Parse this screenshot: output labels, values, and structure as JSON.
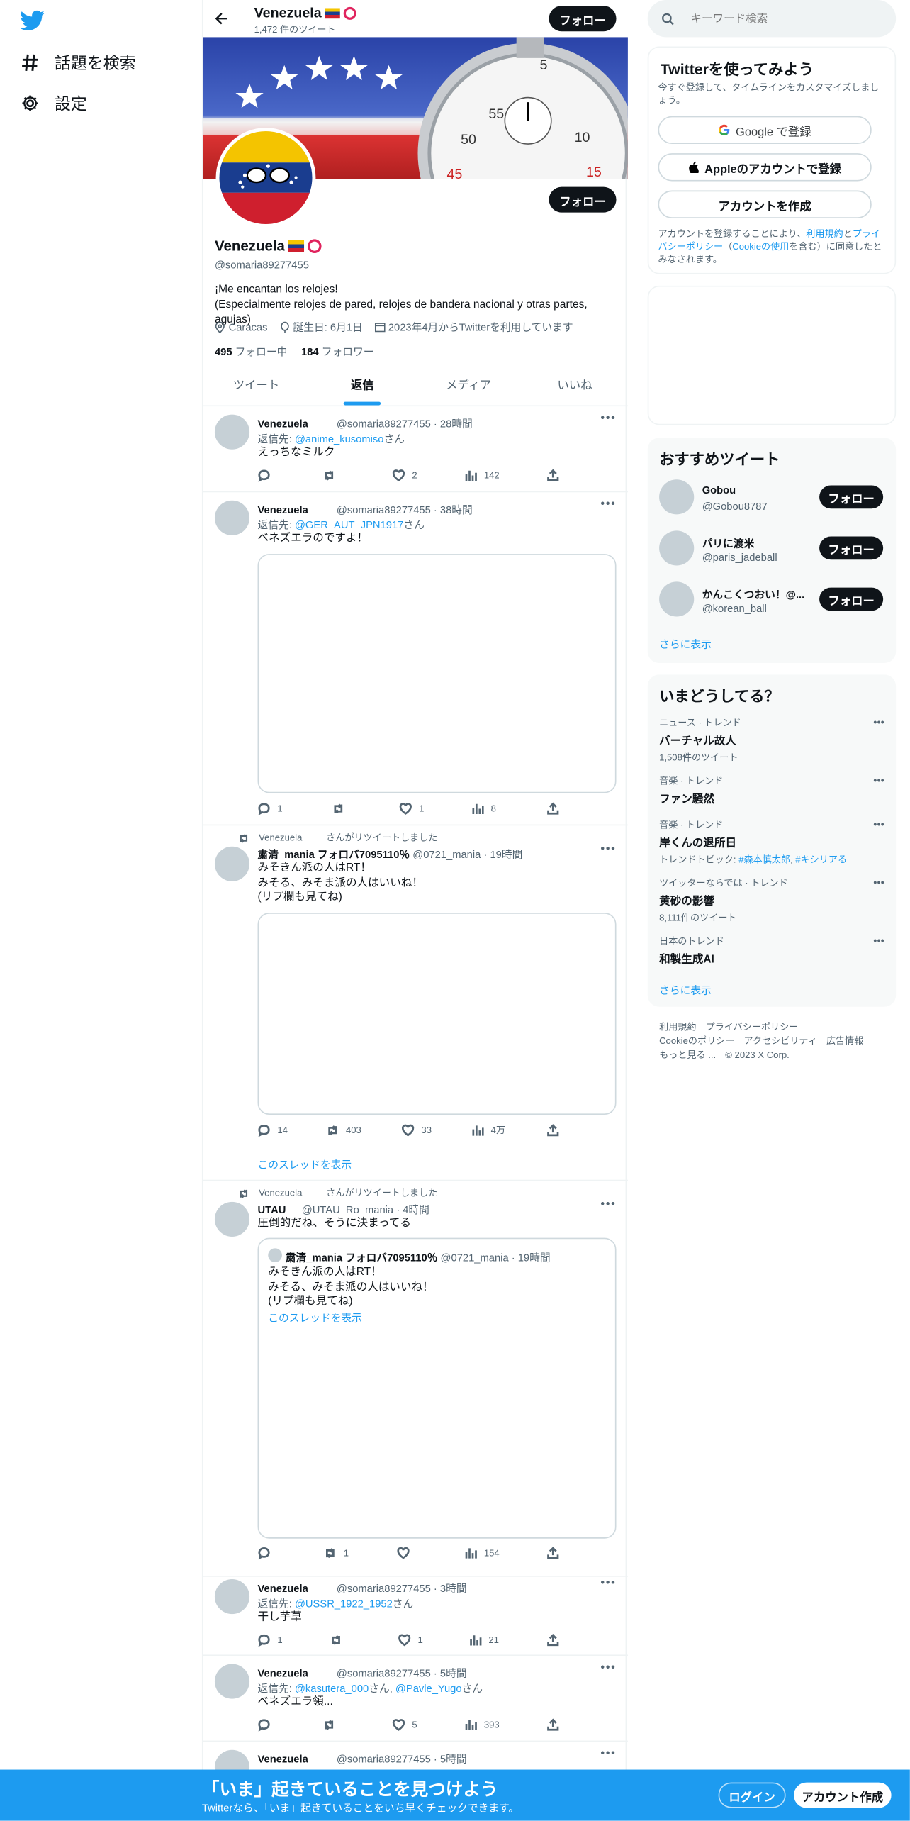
{
  "nav": {
    "explore": "話題を検索",
    "settings": "設定"
  },
  "header": {
    "name": "Venezuela",
    "tweets": "1,472 件のツイート",
    "follow": "フォロー"
  },
  "profile": {
    "name": "Venezuela",
    "handle": "@somaria89277455",
    "bio": "¡Me encantan los relojes!\n(Especialmente relojes de pared, relojes de bandera nacional y otras partes, agujas)",
    "location": "Caracas",
    "birthday": "誕生日: 6月1日",
    "joined": "2023年4月からTwitterを利用しています",
    "following_count": "495",
    "following_label": "フォロー中",
    "followers_count": "184",
    "followers_label": "フォロワー",
    "follow": "フォロー"
  },
  "tabs": [
    "ツイート",
    "返信",
    "メディア",
    "いいね"
  ],
  "tweets": [
    {
      "name": "Venezuela",
      "handle": "@somaria89277455 · 28時間",
      "reply_prefix": "返信先: ",
      "reply_to": "@anime_kusomiso",
      "reply_suffix": "さん",
      "text": "えっちなミルク",
      "reply": "",
      "retweet": "",
      "like": "2",
      "views": "142"
    },
    {
      "name": "Venezuela",
      "handle": "@somaria89277455 · 38時間",
      "reply_prefix": "返信先: ",
      "reply_to": "@GER_AUT_JPN1917",
      "reply_suffix": "さん",
      "text": "ベネズエラのですよ！",
      "reply": "1",
      "retweet": "",
      "like": "1",
      "views": "8"
    },
    {
      "rt_by": "Venezuela",
      "rt_label": "さんがリツイートしました",
      "name": "粛清_mania フォロバ7095110％",
      "handle": "@0721_mania · 19時間",
      "text": "みそきん派の人はRT！\nみそる、みそま派の人はいいね！\n(リプ欄も見てね)",
      "reply": "14",
      "retweet": "403",
      "like": "33",
      "views": "4万",
      "thread": "このスレッドを表示"
    },
    {
      "rt_by": "Venezuela",
      "rt_label": "さんがリツイートしました",
      "name": "UTAU",
      "handle": "@UTAU_Ro_mania · 4時間",
      "text": "圧倒的だね、そうに決まってる",
      "quote": {
        "name": "粛清_mania フォロバ7095110％",
        "handle": "@0721_mania · 19時間",
        "text": "みそきん派の人はRT！\nみそる、みそま派の人はいいね！\n(リプ欄も見てね)",
        "thread": "このスレッドを表示"
      },
      "reply": "",
      "retweet": "1",
      "like": "",
      "views": "154"
    },
    {
      "name": "Venezuela",
      "handle": "@somaria89277455 · 3時間",
      "reply_prefix": "返信先: ",
      "reply_to": "@USSR_1922_1952",
      "reply_suffix": "さん",
      "text": "干し芋草",
      "reply": "1",
      "retweet": "",
      "like": "1",
      "views": "21"
    },
    {
      "name": "Venezuela",
      "handle": "@somaria89277455 · 5時間",
      "reply_prefix": "返信先: ",
      "reply_to": "@kasutera_000",
      "reply_mid": "さん, ",
      "reply_to2": "@Pavle_Yugo",
      "reply_suffix": "さん",
      "text": "ベネズエラ領...",
      "reply": "",
      "retweet": "",
      "like": "5",
      "views": "393"
    },
    {
      "name": "Venezuela",
      "handle": "@somaria89277455 · 5時間"
    }
  ],
  "search": {
    "placeholder": "キーワード検索"
  },
  "signup": {
    "title": "Twitterを使ってみよう",
    "subtitle": "今すぐ登録して、タイムラインをカスタマイズしましょう。",
    "google": "Google で登録",
    "apple": "Appleのアカウントで登録",
    "create": "アカウントを作成",
    "terms_pre": "アカウントを登録することにより、",
    "terms_link": "利用規約",
    "terms_and": "と",
    "privacy_link": "プライバシーポリシー",
    "cookie_pre": "（",
    "cookie_link": "Cookieの使用",
    "terms_post": "を含む）に同意したとみなされます。"
  },
  "suggest": {
    "title": "おすすめツイート",
    "users": [
      {
        "name": "Gobou",
        "handle": "@Gobou8787"
      },
      {
        "name": "パリに渡米",
        "handle": "@paris_jadeball"
      },
      {
        "name": "かんこくつおい！@...",
        "handle": "@korean_ball"
      }
    ],
    "follow": "フォロー",
    "more": "さらに表示"
  },
  "trends": {
    "title": "いまどうしてる？",
    "items": [
      {
        "meta": "ニュース · トレンド",
        "name": "バーチャル故人",
        "count": "1,508件のツイート"
      },
      {
        "meta": "音楽 · トレンド",
        "name": "ファン騒然"
      },
      {
        "meta": "音楽 · トレンド",
        "name": "岸くんの退所日",
        "topic_pre": "トレンドトピック: ",
        "topic1": "#森本慎太郎",
        "topic_sep": ", ",
        "topic2": "#キシリアる"
      },
      {
        "meta": "ツイッターならでは · トレンド",
        "name": "黄砂の影響",
        "count": "8,111件のツイート"
      },
      {
        "meta": "日本のトレンド",
        "name": "和製生成AI"
      }
    ],
    "more": "さらに表示"
  },
  "footer_links": {
    "terms": "利用規約",
    "privacy": "プライバシーポリシー",
    "cookie": "Cookieのポリシー",
    "access": "アクセシビリティ",
    "ads": "広告情報",
    "more": "もっと見る ...",
    "copy": "© 2023 X Corp."
  },
  "banner": {
    "title": "「いま」起きていることを見つけよう",
    "sub": "Twitterなら、「いま」起きていることをいち早くチェックできます。",
    "login": "ログイン",
    "signup": "アカウント作成"
  },
  "colors": {
    "accent": "#1d9bf0",
    "text": "#0f1419",
    "muted": "#536471"
  }
}
